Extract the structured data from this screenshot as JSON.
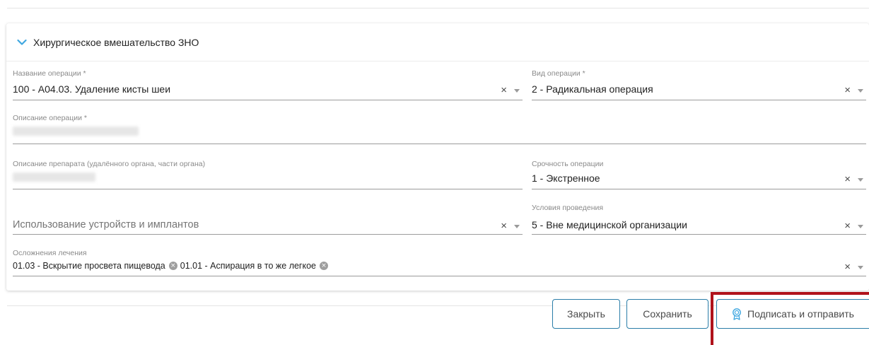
{
  "section": {
    "title": "Хирургическое вмешательство ЗНО"
  },
  "fields": {
    "operation_name": {
      "label": "Название операции *",
      "value": "100 - А04.03. Удаление кисты шеи"
    },
    "operation_type": {
      "label": "Вид операции *",
      "value": "2 - Радикальная операция"
    },
    "operation_description": {
      "label": "Описание операции *"
    },
    "drug_description": {
      "label": "Описание препарата (удалённого органа, части органа)"
    },
    "operation_urgency": {
      "label": "Срочность операции",
      "value": "1 - Экстренное"
    },
    "devices_usage": {
      "placeholder": "Использование устройств и имплантов"
    },
    "conditions": {
      "label": "Условия проведения",
      "value": "5 - Вне медицинской организации"
    },
    "complications": {
      "label": "Осложнения лечения",
      "chips": [
        "01.03 - Вскрытие просвета пищевода",
        "01.01 - Аспирация в то же легкое"
      ]
    }
  },
  "icons": {
    "clear": "×",
    "chip_remove": "×"
  },
  "buttons": {
    "close_label": "Закрыть",
    "save_label": "Сохранить",
    "sign_label": "Подписать и отправить"
  },
  "colors": {
    "accent": "#2a7da8",
    "chevron": "#3fa7e0",
    "highlight": "#b0121b"
  }
}
